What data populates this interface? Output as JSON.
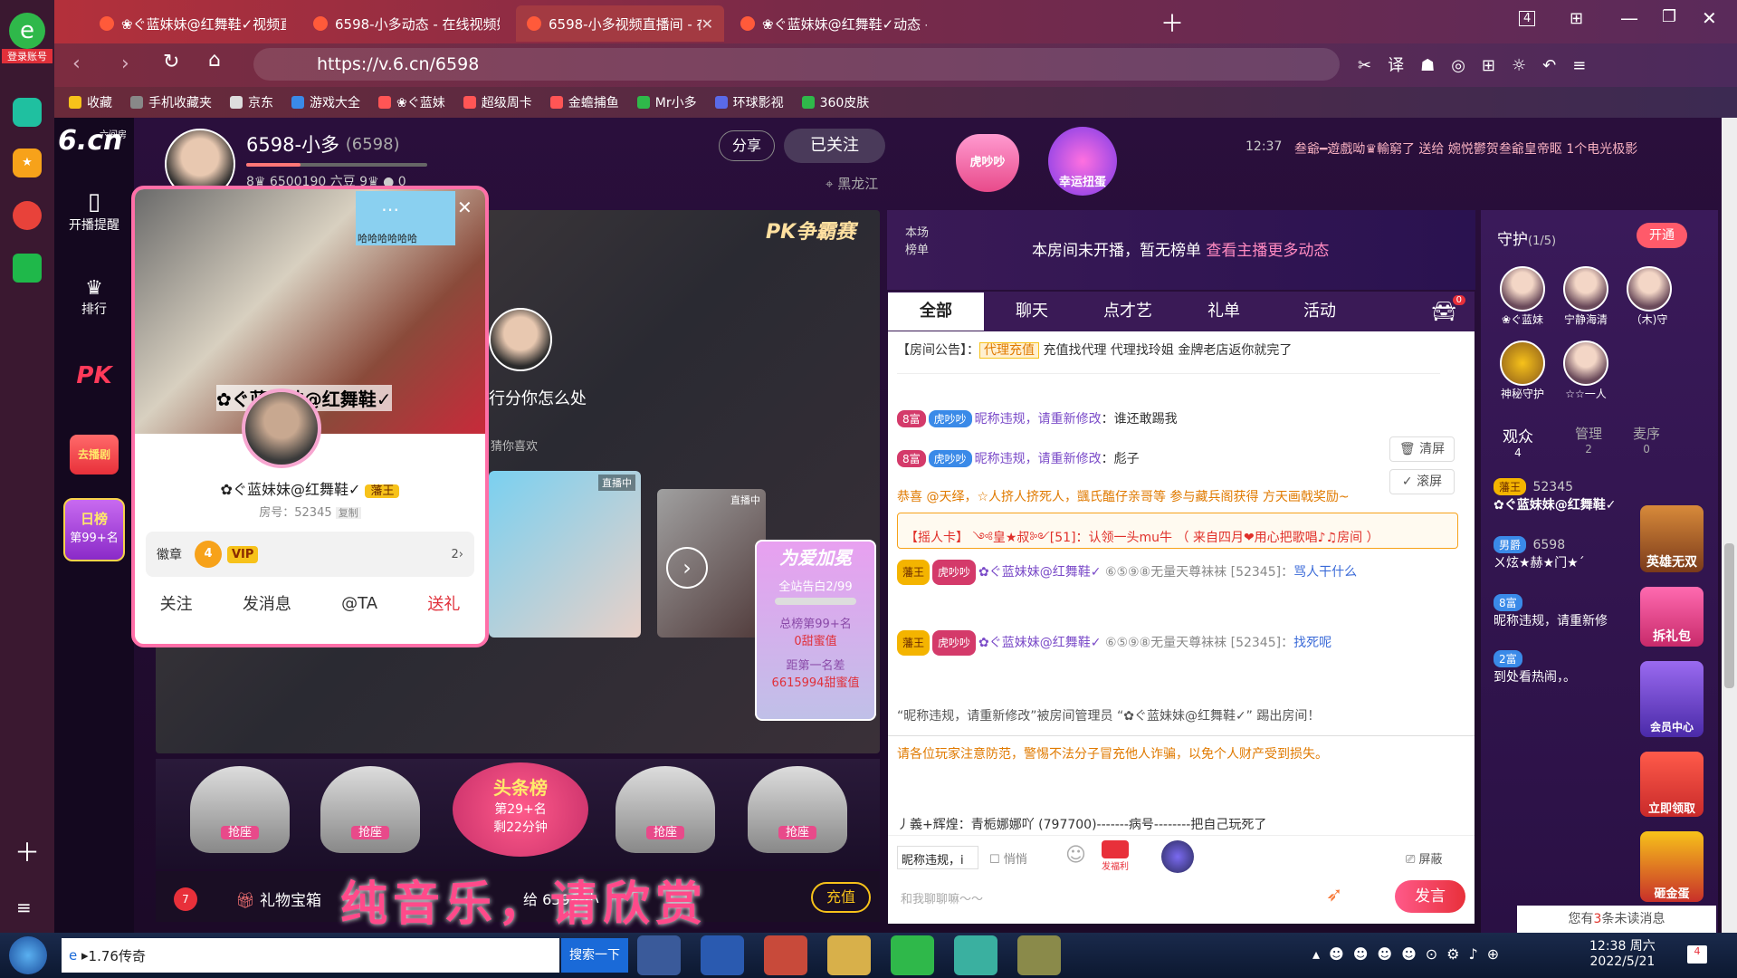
{
  "browser": {
    "login_label": "登录账号",
    "tabs": [
      {
        "label": "❀ぐ蓝妹妹@红舞鞋✓视频直播",
        "active": false
      },
      {
        "label": "6598-小多动态 - 在线视频娱乐",
        "active": false
      },
      {
        "label": "6598-小多视频直播间 - 在线",
        "active": true
      },
      {
        "label": "❀ぐ蓝妹妹@红舞鞋✓动态 - 在",
        "active": false
      }
    ],
    "tab_count": "4",
    "url": "https://v.6.cn/6598",
    "bookmarks": [
      "收藏",
      "手机收藏夹",
      "京东",
      "游戏大全",
      "❀ぐ蓝妹",
      "超级周卡",
      "金蟾捕鱼",
      "Mr小多",
      "环球影视",
      "360皮肤"
    ]
  },
  "site": {
    "logo": "6.cn",
    "logo_sub": "六间房",
    "nav": [
      {
        "label": "开播提醒",
        "icon": "phone-icon"
      },
      {
        "label": "排行",
        "icon": "crown-icon"
      },
      {
        "label": "PK",
        "icon": "pk-icon"
      },
      {
        "label": "去播剧",
        "icon": "drama-icon"
      },
      {
        "label": "日榜",
        "icon": "rank-icon"
      },
      {
        "label": "第99+名",
        "icon": ""
      }
    ]
  },
  "anchor": {
    "name": "6598-小多",
    "room": "(6598)",
    "beans": "6500190 六豆",
    "fans": "0",
    "location": "黑龙江",
    "share_label": "分享",
    "follow_label": "已关注",
    "pk_label": "PK争霸赛",
    "lucky_label": "幸运扭蛋",
    "tiger_label": "虎吵吵",
    "ticker_time": "12:37",
    "ticker_text": "叁爺━遊戲呦♛輸窮了 送给 婉悦鬱贺叁爺皇帝眍 1个电光极影"
  },
  "card": {
    "name": "✿ぐ蓝妹妹@红舞鞋✓",
    "title_badge": "藩王",
    "room_no": "房号：52345",
    "copy": "复制",
    "medal_label": "徽章",
    "medal_count": "2",
    "vip": "VIP",
    "level": "4",
    "actions": [
      "关注",
      "发消息",
      "@TA",
      "送礼"
    ],
    "banner_name": "✿ぐ蓝妹妹@红舞鞋✓",
    "sticker": "哈哈哈哈哈哈",
    "guess_like": "猜你喜欢",
    "behind_text": "行分你怎么处"
  },
  "video": {
    "live_label": "直播中",
    "love_title": "为爱加冕",
    "love_sub": "全站告白2/99",
    "love_rank": "总榜第99+名",
    "love_val": "0甜蜜值",
    "love_gap": "距第一名差",
    "love_gap_val": "6615994甜蜜值",
    "seats": [
      "抢座",
      "抢座",
      "抢座",
      "抢座"
    ],
    "headline": "头条榜",
    "headline_rank": "第29+名",
    "headline_time": "剩22分钟",
    "gift_box": "礼物宝箱",
    "gift_to": "给 6598-小",
    "recharge": "充值",
    "subtitle": "纯音乐，请欣赏",
    "gift_count": "7"
  },
  "ranklist": {
    "label": "本场榜单",
    "empty": "本房间未开播，暂无榜单",
    "link": "查看主播更多动态"
  },
  "chat": {
    "tabs": [
      "全部",
      "聊天",
      "点才艺",
      "礼单",
      "活动"
    ],
    "car_badge": "0",
    "notice_label": "【房间公告】：",
    "notice_tag": "代理充值",
    "notice_text": "充值找代理 代理找玲姐 金牌老店返你就完了",
    "clear": "清屏",
    "scroll": "滚屏",
    "messages": [
      {
        "badge": "8富",
        "tag": "虎吵吵",
        "name": "昵称违规，请重新修改",
        "text": "：谁还敢踢我"
      },
      {
        "badge": "8富",
        "tag": "虎吵吵",
        "name": "昵称违规，请重新修改",
        "text": "：彪子"
      },
      {
        "system": "恭喜 @天绎，☆人挤人挤死人，颽氏醢仔亲哥等 参与藏兵阁获得 方天画戟奖励~"
      },
      {
        "card": "【摇人卡】 ༺皇★叔༻[51]：认领一头mu牛 （ 来自四月❤用心把歌唱♪♫房间 ）"
      },
      {
        "badge": "藩王",
        "tag": "虎吵吵",
        "name": "✿ぐ蓝妹妹@红舞鞋✓",
        "target": "⑥⑤⑨⑧无量天尊袜袜 [52345]：",
        "text": "骂人干什么"
      },
      {
        "badge": "藩王",
        "tag": "虎吵吵",
        "name": "✿ぐ蓝妹妹@红舞鞋✓",
        "target": "⑥⑤⑨⑧无量天尊袜袜 [52345]：",
        "text": "找死呢"
      },
      {
        "kick": "“昵称违规，请重新修改”被房间管理员 “✿ぐ蓝妹妹@红舞鞋✓” 踢出房间！"
      }
    ],
    "warning": "请各位玩家注意防范，警惕不法分子冒充他人诈骗，以免个人财产受到损失。",
    "last_msg": "丿義+辉煌：青栀娜娜吖 (797700)-------病号--------把自己玩死了",
    "input_target": "昵称违规，i",
    "quiet": "悄悄",
    "fuli": "发福利",
    "block": "屏蔽",
    "placeholder": "和我聊聊嘛～～",
    "send": "发言"
  },
  "guard": {
    "title": "守护",
    "count": "(1/5)",
    "open": "开通",
    "members": [
      "❀ぐ蓝妹",
      "宁静海清",
      "（木)守",
      "神秘守护",
      "☆☆一人"
    ],
    "tabs": [
      {
        "label": "观众",
        "count": "4"
      },
      {
        "label": "管理",
        "count": "2"
      },
      {
        "label": "麦序",
        "count": "0"
      }
    ],
    "audience": [
      {
        "badge": "藩王",
        "name": "✿ぐ蓝妹妹@红舞鞋✓",
        "id": "52345"
      },
      {
        "badge": "男爵",
        "name": "ㄨ炫★赫★门★ˊ",
        "id": "6598"
      },
      {
        "badge": "8富",
        "name": "昵称违规，请重新修"
      },
      {
        "badge": "2富",
        "name": "到处看热闹，。"
      }
    ],
    "side_banners": [
      "英雄无双",
      "拆礼包",
      "会员中心",
      "立即领取",
      "砸金蛋"
    ],
    "unread": "您有3条未读消息",
    "unread_count": "3"
  },
  "taskbar": {
    "item": "1.76传奇",
    "search": "搜索一下",
    "time": "12:38 周六",
    "date": "2022/5/21",
    "notify_count": "4"
  }
}
